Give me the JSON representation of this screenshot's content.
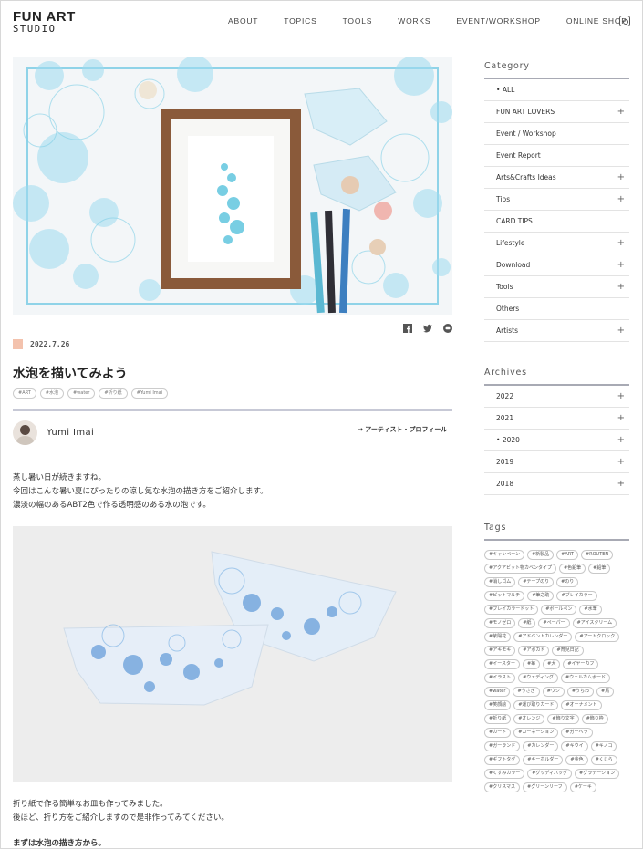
{
  "logo": {
    "line1": "FUN ART",
    "line2": "STUDIO"
  },
  "nav": {
    "items": [
      "ABOUT",
      "TOPICS",
      "TOOLS",
      "WORKS",
      "EVENT/WORKSHOP",
      "ONLINE SHOP"
    ],
    "instagram_icon": "instagram-icon"
  },
  "post": {
    "date": "2022.7.26",
    "title": "水泡を描いてみよう",
    "tags": [
      "#ART",
      "#水泡",
      "#water",
      "#折り紙",
      "#Yumi Imai"
    ],
    "author": "Yumi Imai",
    "profile_link": "→ アーティスト・プロフィール",
    "intro": [
      "蒸し暑い日が続きますね。",
      "今回はこんな暑い夏にぴったりの涼し気な水泡の描き方をご紹介します。",
      "濃淡の幅のあるABT2色で作る透明感のある水の泡です。"
    ],
    "after": [
      "折り紙で作る簡単なお皿も作ってみました。",
      "後ほど、折り方をご紹介しますので是非作ってみてください。"
    ],
    "heading": "まずは水泡の描き方から。",
    "share_icons": [
      "facebook-icon",
      "twitter-icon",
      "line-icon"
    ]
  },
  "sidebar": {
    "category_title": "Category",
    "categories": [
      {
        "label": "ALL",
        "plus": ""
      },
      {
        "label": "FUN ART LOVERS",
        "plus": "+"
      },
      {
        "label": "Event / Workshop",
        "plus": ""
      },
      {
        "label": "Event Report",
        "plus": ""
      },
      {
        "label": "Arts&Crafts Ideas",
        "plus": "+"
      },
      {
        "label": "Tips",
        "plus": "+"
      },
      {
        "label": "CARD TIPS",
        "plus": ""
      },
      {
        "label": "Lifestyle",
        "plus": "+"
      },
      {
        "label": "Download",
        "plus": "+"
      },
      {
        "label": "Tools",
        "plus": "+"
      },
      {
        "label": "Others",
        "plus": ""
      },
      {
        "label": "Artists",
        "plus": "+"
      }
    ],
    "archives_title": "Archives",
    "archives": [
      {
        "label": "2022",
        "plus": "+"
      },
      {
        "label": "2021",
        "plus": "+"
      },
      {
        "label": "2020",
        "plus": "+"
      },
      {
        "label": "2019",
        "plus": "+"
      },
      {
        "label": "2018",
        "plus": "+"
      }
    ],
    "tags_title": "Tags",
    "tags": [
      "#キャンペーン",
      "#新製品",
      "#ART",
      "#ROUTEN",
      "#アクアビット物カベンタイプ",
      "#色鉛筆",
      "#鉛筆",
      "#消しゴム",
      "#テープのり",
      "#のり",
      "#ピットマルチ",
      "#筆之助",
      "#ブレイカラー",
      "#ブレイカラードット",
      "#ボールペン",
      "#水筆",
      "#モノゼロ",
      "#紙",
      "#ペーパー",
      "#アイスクリーム",
      "#紫陽花",
      "#アドベントカレンダー",
      "#アートクロック",
      "#アキモキ",
      "#アボカド",
      "#育児日記",
      "#イースター",
      "#苺",
      "#犬",
      "#イヤーカフ",
      "#イラスト",
      "#ウェディング",
      "#ウェルカムボード",
      "#water",
      "#うさぎ",
      "#ウシ",
      "#うちわ",
      "#馬",
      "#笑顔絵",
      "#運び取りカード",
      "#オーナメント",
      "#折り紙",
      "#オレンジ",
      "#飾り文字",
      "#飾り枠",
      "#カード",
      "#カーネーション",
      "#ガーベラ",
      "#ガーランド",
      "#カレンダー",
      "#キウイ",
      "#キノコ",
      "#ギフトタグ",
      "#キーホルダー",
      "#金色",
      "#くじら",
      "#くすみカラー",
      "#グッディバッグ",
      "#グラデーション",
      "#クリスマス",
      "#グリーンリーフ",
      "#ケーキ"
    ]
  },
  "colors": {
    "accent_square": "#f3c2ad",
    "rule": "#c7c9d6",
    "sidebar_rule": "#a8aab4"
  }
}
